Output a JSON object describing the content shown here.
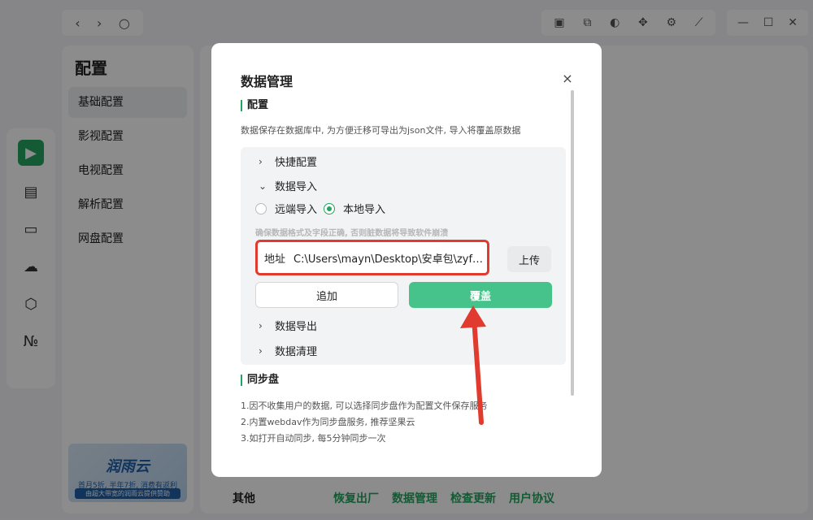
{
  "app": {
    "nav": {
      "back": "‹",
      "forward": "›",
      "refresh": "○"
    },
    "toolbar_icons": [
      "store-icon",
      "translate-icon",
      "theme-icon",
      "plugin-icon",
      "settings-icon",
      "pin-icon"
    ],
    "window": {
      "minimize": "—",
      "maximize": "☐",
      "close": "✕"
    },
    "sidebar_icons": [
      "film-icon",
      "tv-icon",
      "cloud-icon",
      "scan-icon",
      "number-icon"
    ]
  },
  "settings": {
    "title": "配置",
    "items": [
      {
        "label": "基础配置",
        "active": true
      },
      {
        "label": "影视配置",
        "active": false
      },
      {
        "label": "电视配置",
        "active": false
      },
      {
        "label": "解析配置",
        "active": false
      },
      {
        "label": "网盘配置",
        "active": false
      }
    ]
  },
  "ad": {
    "brand": "润雨云",
    "promo": "首月5折, 半年7折, 消费有返利",
    "sub": "由超大带宽的润雨云提供赞助"
  },
  "bottom": {
    "label": "其他",
    "links": [
      "恢复出厂",
      "数据管理",
      "检查更新",
      "用户协议"
    ]
  },
  "dialog": {
    "title": "数据管理",
    "close": "×",
    "config_section": {
      "title": "配置",
      "desc": "数据保存在数据库中, 为方便迁移可导出为json文件, 导入将覆盖原数据",
      "quick": "快捷配置",
      "import": "数据导入",
      "remote": "远端导入",
      "local": "本地导入",
      "selected_mode": "本地导入",
      "warning": "确保数据格式及字段正确, 否则脏数据将导致软件崩溃",
      "addr_label": "地址",
      "addr_value": "C:\\Users\\mayn\\Desktop\\安卓包\\zyfun.json",
      "upload": "上传",
      "add": "追加",
      "cover": "覆盖",
      "export": "数据导出",
      "clean": "数据清理"
    },
    "sync_section": {
      "title": "同步盘",
      "lines": [
        "1.因不收集用户的数据, 可以选择同步盘作为配置文件保存服务",
        "2.内置webdav作为同步盘服务, 推荐坚果云",
        "3.如打开自动同步, 每5分钟同步一次"
      ]
    }
  },
  "colors": {
    "accent": "#23a461",
    "cover_button": "#46c38a",
    "highlight": "#e03b2e"
  }
}
